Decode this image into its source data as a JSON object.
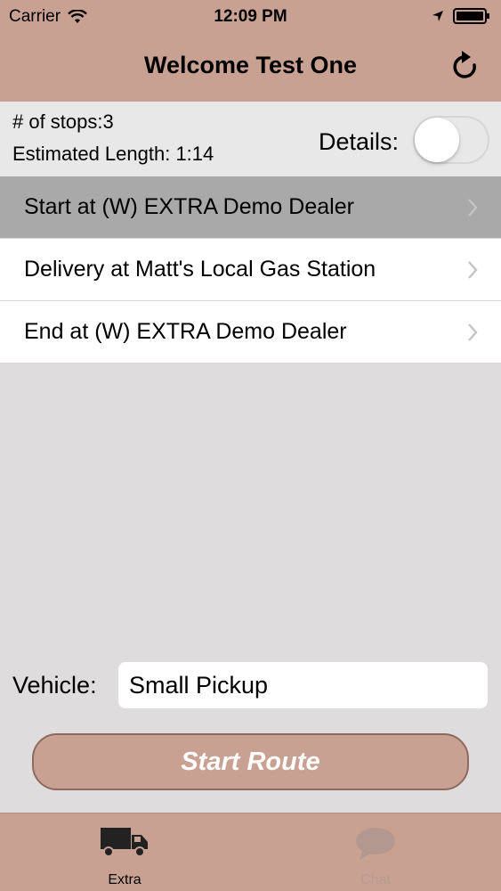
{
  "status_bar": {
    "carrier": "Carrier",
    "time": "12:09 PM"
  },
  "nav": {
    "title": "Welcome Test One",
    "refresh_icon": "refresh-icon"
  },
  "summary": {
    "stops_text": "# of stops:3",
    "estimated_length_text": "Estimated Length:  1:14",
    "details_label": "Details:",
    "details_on": false
  },
  "stops": [
    {
      "label": "Start at (W) EXTRA Demo Dealer",
      "selected": true
    },
    {
      "label": "Delivery at Matt's Local Gas Station",
      "selected": false
    },
    {
      "label": "End at (W) EXTRA Demo Dealer",
      "selected": false
    }
  ],
  "vehicle": {
    "label": "Vehicle:",
    "value": "Small Pickup"
  },
  "start_route_label": "Start Route",
  "tabs": [
    {
      "label": "Extra",
      "icon": "truck-icon",
      "active": true
    },
    {
      "label": "Chat",
      "icon": "chat-bubble-icon",
      "active": false
    }
  ],
  "colors": {
    "brand": "#c9a193",
    "background": "#dedcdc",
    "selected_row": "#aaa9a9"
  }
}
